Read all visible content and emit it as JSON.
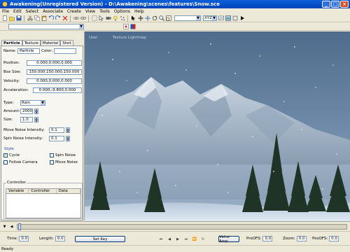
{
  "window": {
    "title": "Awakening(Unregistered Version) - D:\\Awakening\\scenes\\features\\Snow.sce",
    "controls": [
      "_",
      "□",
      "×"
    ]
  },
  "menu": [
    "File",
    "Edit",
    "Select",
    "Associate",
    "Create",
    "View",
    "Tools",
    "Options",
    "Help"
  ],
  "toolbar": {
    "axis_combo": "XYZ",
    "icons": [
      "new-icon",
      "open-icon",
      "save-icon",
      "cut-icon",
      "copy-icon",
      "paste-icon",
      "undo-icon",
      "redo-icon",
      "delete-icon",
      "select-icon",
      "link-icon",
      "unlink-icon",
      "move-icon",
      "rotate-icon",
      "scale-icon",
      "zoom-icon",
      "pan-icon",
      "arrow-icon",
      "region-icon",
      "render-icon",
      "camera-icon",
      "light-icon",
      "particle-icon",
      "play-icon"
    ]
  },
  "tabs": [
    "Particle",
    "Texture",
    "Material",
    "Shot"
  ],
  "particle": {
    "name_label": "Name:",
    "name_value": "Particle",
    "color_label": "Color:",
    "position_label": "Position:",
    "position_value": "0.000,0.000,0.000",
    "boxsize_label": "Box Size:",
    "boxsize_value": "150.000,150.000,150.000",
    "velocity_label": "Velocity:",
    "velocity_value": "0.000,0.000,0.000",
    "accel_label": "Acceleration:",
    "accel_value": "0.000,-9.800,0.000",
    "type_label": "Type:",
    "type_value": "Rain",
    "amount_label": "Amount:",
    "amount_value": "2000",
    "size_label": "Size:",
    "size_value": "1.0",
    "move_noise_label": "Move Noise Intensity:",
    "move_noise_value": "0.1",
    "spin_noise_label": "Spin Noise Intensity:",
    "spin_noise_value": "0.1",
    "style_title": "Style",
    "cycle_label": "Cycle",
    "cycle_checked": true,
    "spin_noise_cb_label": "Spin Noise",
    "follow_camera_label": "Follow Camera",
    "move_noise_cb_label": "Move Noise",
    "controller_title": "Controller",
    "grid_headers": [
      "Variable",
      "Controller",
      "Data"
    ]
  },
  "viewport": {
    "label_left": "User",
    "label_mid": "Texture Lightmap"
  },
  "transport": {
    "time_label": "Time:",
    "time_value": "0.0",
    "length_label": "Length:",
    "length_value": "0.0",
    "setkey_label": "Set Key",
    "value_amp_label": "Value Amp.",
    "pro_ofs_label": "ProOFS:",
    "pro_ofs_value": "0.0",
    "zoom_label": "Zoom:",
    "zoom_value": "0.0",
    "pos_ofs_label": "PosOFS:",
    "pos_ofs_value": "0.0"
  },
  "status": "Ready"
}
